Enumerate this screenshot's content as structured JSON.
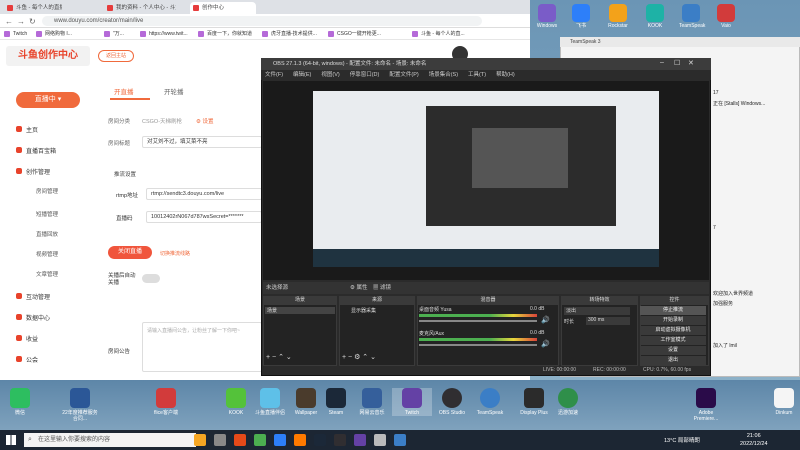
{
  "browser": {
    "tabs": [
      "斗鱼 - 每个人的直播平台",
      "我的资料 - 个人中心 - 斗鱼",
      "创作中心"
    ],
    "url": "www.douyu.com/creator/main/live",
    "bookmarks": [
      "Twitch",
      "网络购物 I...",
      "\"万...",
      "https://www.twit...",
      "百度一下，你就知道",
      "虎牙直播-技术提供...",
      "CSGO一键开枪更...",
      "斗鱼 - 每个人的直..."
    ]
  },
  "page": {
    "logo": "斗鱼创作中心",
    "back_button": "返回主站",
    "live_button": "直播中",
    "nav": [
      {
        "label": "主页"
      },
      {
        "label": "直播百宝箱"
      },
      {
        "label": "创作管理"
      },
      {
        "label": "互动管理"
      },
      {
        "label": "数据中心"
      },
      {
        "label": "收益"
      },
      {
        "label": "公会"
      }
    ],
    "subnav": [
      "房间管理",
      "短播管理",
      "直播回放",
      "视频管理",
      "文章管理"
    ],
    "tabs": [
      "开直播",
      "开轮播"
    ],
    "room_category_label": "房间分类",
    "room_category_value": "CSGO-天梯刷枪",
    "room_category_action": "设置",
    "room_title_label": "房间标题",
    "room_title_value": "对艾刘不过，填艾菜不亮",
    "push_section": "推流设置",
    "rtmp_label": "rtmp地址",
    "rtmp_value": "rtmp://sendtc3.douyu.com/live",
    "stream_code_label": "直播码",
    "stream_code_value": "10012402rN067d787wsSecret=*******",
    "close_live_button": "关闭直播",
    "switch_link": "切换推流线路",
    "auto_close_label": "关播后自动关播",
    "notice_label": "房间公告",
    "notice_placeholder": "请输入直播间公告，让粉丝了解一下你吧~"
  },
  "obs": {
    "title": "OBS 27.1.3 (64-bit, windows) - 配置文件: 未命名 - 场景: 未命名",
    "menu": [
      "文件(F)",
      "编辑(E)",
      "视图(V)",
      "停靠窗口(D)",
      "配置文件(P)",
      "场景集合(S)",
      "工具(T)",
      "帮助(H)"
    ],
    "source_bar": "未选择源",
    "props_button": "属性",
    "filters_button": "滤镜",
    "docks": {
      "scenes": {
        "title": "场景",
        "items": [
          "场景"
        ]
      },
      "sources": {
        "title": "来源",
        "items": [
          "显示器采集"
        ]
      },
      "mixer": {
        "title": "混音器",
        "channels": [
          "桌面音频 Yusa",
          "麦克风/Aux"
        ],
        "levels": [
          "0.0 dB",
          "0.0 dB"
        ]
      },
      "transitions": {
        "title": "转场特效",
        "type": "淡出",
        "duration_label": "时长",
        "duration": "300 ms"
      },
      "controls": {
        "title": "控件",
        "buttons": [
          "停止推流",
          "开始录制",
          "启动虚拟摄像机",
          "工作室模式",
          "设置",
          "退出"
        ]
      }
    },
    "status": {
      "live": "LIVE: 00:00:00",
      "rec": "REC: 00:00:00",
      "cpu": "CPU: 0.7%, 60.00 fps"
    }
  },
  "teamspeak": {
    "title": "TeamSpeak 3",
    "log": [
      "17",
      "正在 [Stalls] Windows...",
      "7",
      "欢迎加入世界频道",
      "加强服务",
      "加入了 lmil"
    ]
  },
  "desktop_top_icons": [
    {
      "label": "Windows",
      "color": "#7a5cc8"
    },
    {
      "label": "飞书",
      "color": "#2d7ff9"
    },
    {
      "label": "Rockstar",
      "color": "#f3a21a"
    },
    {
      "label": "KOOK",
      "color": "#1eb2a6"
    },
    {
      "label": "TeamSpeak",
      "color": "#3b7ec6"
    },
    {
      "label": "Vaio",
      "color": "#d23b3b"
    }
  ],
  "desktop_icons": [
    {
      "label": "微信",
      "color": "#2dbe60"
    },
    {
      "label": "22年度推荐服务合同...",
      "color": "#2b5797"
    },
    {
      "label": "flice客户端",
      "color": "#d23b3b"
    },
    {
      "label": "KOOK",
      "color": "#54c23a"
    },
    {
      "label": "斗鱼直播伴侣",
      "color": "#5ec0e8"
    },
    {
      "label": "Wallpaper",
      "color": "#4a3b2c"
    },
    {
      "label": "Steam",
      "color": "#1b2838"
    },
    {
      "label": "网易云音乐",
      "color": "#355f9b"
    },
    {
      "label": "Twitch",
      "color": "#6441a5"
    },
    {
      "label": "OBS Studio",
      "color": "#302e31"
    },
    {
      "label": "TeamSpeak",
      "color": "#3b7ec6"
    },
    {
      "label": "Display Plus",
      "color": "#2b2b2b"
    },
    {
      "label": "迅游加速",
      "color": "#2f8f4a"
    },
    {
      "label": "Adobe Premiere...",
      "color": "#2a0b49"
    },
    {
      "label": "Dinkum",
      "color": "#f5f5f5"
    }
  ],
  "taskbar": {
    "search_placeholder": "在这里输入你要搜索的内容",
    "weather": "13°C 局部晴朗",
    "time": "21:06",
    "date": "2022/12/24",
    "icons": [
      "#f5a623",
      "#888888",
      "#e64a19",
      "#4caf50",
      "#2d7ff9",
      "#ff7a00",
      "#1b2838",
      "#302e31",
      "#6441a5",
      "#bbbbbb",
      "#3b7ec6"
    ]
  }
}
